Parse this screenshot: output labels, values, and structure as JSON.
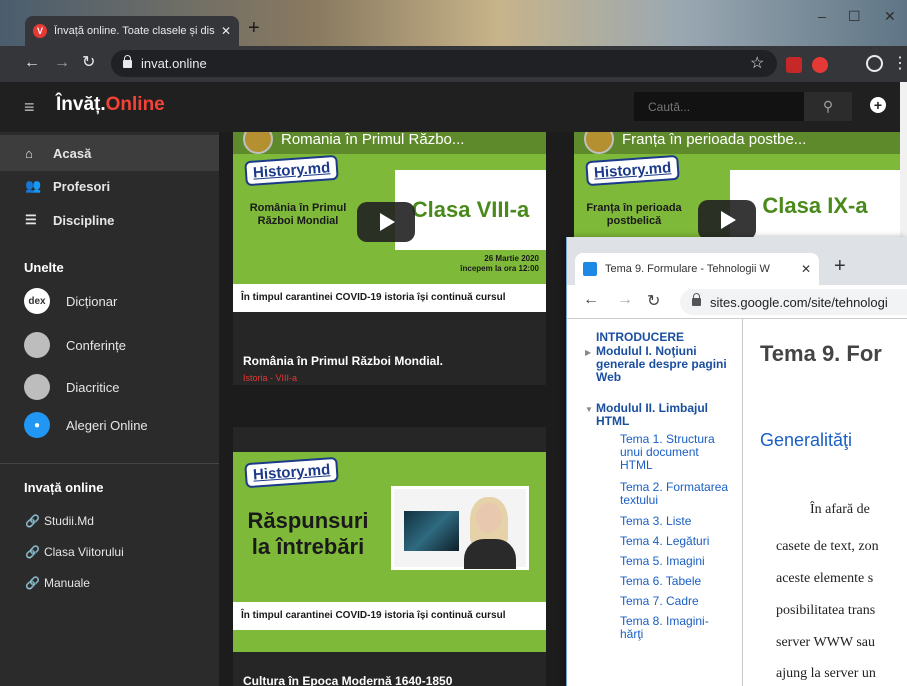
{
  "browser1": {
    "tab_title": "Învață online. Toate clasele și disc",
    "favicon": "V",
    "url": "invat.online",
    "controls": {
      "minimize": "–",
      "maximize": "☐",
      "close": "✕"
    }
  },
  "site": {
    "logo_main": "Învăț.",
    "logo_accent": "Online",
    "search_placeholder": "Caută...",
    "accent_color": "#f44336"
  },
  "sidebar": {
    "nav": [
      {
        "label": "Acasă",
        "icon": "home-icon"
      },
      {
        "label": "Profesori",
        "icon": "users-icon"
      },
      {
        "label": "Discipline",
        "icon": "list-icon"
      }
    ],
    "tools_heading": "Unelte",
    "tools": [
      {
        "label": "Dicționar",
        "avatar": "dex"
      },
      {
        "label": "Conferințe",
        "avatar": ""
      },
      {
        "label": "Diacritice",
        "avatar": ""
      },
      {
        "label": "Alegeri Online",
        "avatar": ""
      }
    ],
    "learn_heading": "Invață online",
    "links": [
      {
        "label": "Studii.Md"
      },
      {
        "label": "Clasa Viitorului"
      },
      {
        "label": "Manuale"
      }
    ]
  },
  "cards": [
    {
      "yt_title": "Romania în Primul Războ...",
      "logo": "History.md",
      "subject": "România în Primul Război Mondial",
      "class_label": "Clasa VIII-a",
      "date_line1": "26 Martie 2020",
      "date_line2": "începem la ora 12:00",
      "footer": "În timpul carantinei COVID-19 istoria își continuă cursul",
      "title": "România în Primul Război Mondial.",
      "sub": "Istoria - VIII-a"
    },
    {
      "yt_title": "Franța în perioada postbe...",
      "logo": "History.md",
      "subject": "Franța în perioada postbelică",
      "class_label": "Clasa IX-a"
    },
    {
      "logo": "History.md",
      "headline1": "Răspunsuri",
      "headline2": "la întrebări",
      "footer": "În timpul carantinei COVID-19 istoria își continuă cursul",
      "title": "Cultura în Epoca Modernă 1640-1850"
    }
  ],
  "browser2": {
    "tab_title": "Tema 9. Formulare - Tehnologii W",
    "url": "sites.google.com/site/tehnologi",
    "nav": [
      {
        "label": "INTRODUCERE",
        "lines": [
          "INTRODUCERE"
        ]
      },
      {
        "label": "Modulul I. Noţiuni generale despre pagini Web",
        "lines": [
          "Modulul I. Noţiuni",
          "generale despre pagini",
          "Web"
        ]
      },
      {
        "label": "Modulul II. Limbajul HTML",
        "lines": [
          "Modulul II. Limbajul",
          "HTML"
        ]
      }
    ],
    "subnav": [
      {
        "lines": [
          "Tema 1. Structura",
          "unui document",
          "HTML"
        ]
      },
      {
        "lines": [
          "Tema 2. Formatarea",
          "textului"
        ]
      },
      {
        "lines": [
          "Tema 3. Liste"
        ]
      },
      {
        "lines": [
          "Tema 4. Legături"
        ]
      },
      {
        "lines": [
          "Tema 5. Imagini"
        ]
      },
      {
        "lines": [
          "Tema 6. Tabele"
        ]
      },
      {
        "lines": [
          "Tema 7. Cadre"
        ]
      },
      {
        "lines": [
          "Tema 8. Imagini-",
          "hărţi"
        ]
      }
    ],
    "heading": "Tema 9. For",
    "subheading": "Generalităţi",
    "paragraph": [
      "În afară de",
      "casete de text, zon",
      "aceste elemente s",
      "posibilitatea trans",
      "server WWW sau",
      "ajung la server un"
    ]
  }
}
